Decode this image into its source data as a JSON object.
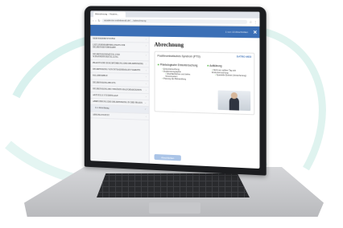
{
  "browser": {
    "tab_title": "Abrechnung – Nutzim...",
    "url": "academie.smilebrandt.de/..../abrechnung"
  },
  "app": {
    "header_meta": "1 von 13 Abschnitten",
    "close_glyph": "✕"
  },
  "sidebar": {
    "items": [
      {
        "label": "NERVENDEBITSYSTEM"
      },
      {
        "label": "LEITLINIENEMPFEHLUNGEN ZUR DELIRENSIENTHERAPIE"
      },
      {
        "label": "DELIRENSIONSMITTEL UND SCHANNERVERSTELLUNG"
      },
      {
        "label": "PRAKTISCHE DURCHFÜHRUNG DER DELIRENSIONG"
      },
      {
        "label": "DELIRENSIONG VON INTRADERMALEN VARIZEN"
      },
      {
        "label": "FALLBEISPIELE"
      },
      {
        "label": "DELIRENSIONG BEI PTS"
      },
      {
        "label": "DELIRENSIONG BEI VENÖSEN MALFORMATIONEN"
      },
      {
        "label": "AKTUELLE STUDIENLAGE"
      },
      {
        "label": "ABRECHNUNG DER DELIRENSIONG IN DER PRAXIS"
      },
      {
        "label": "11.1 Abrechnung"
      },
      {
        "label": "ABSCHLUSSTEST"
      }
    ]
  },
  "main": {
    "title": "Abrechnung",
    "card_title": "Postthrombotisches Syndrom (PTS)",
    "logo_text": "DATRO MED",
    "left_heading": "Phlebologische Erstuntersuchung",
    "left_items": [
      "Erstuntersuchung",
      "Duplexsonographie",
      "Oberflächliches und tiefes Venensystem",
      "Planung der Behandlung"
    ],
    "right_heading": "Aufklärung",
    "right_items": [
      "Nicht am selben Tag wie Erstuntersuchung",
      "Spezielle Einheit (Versicherung)"
    ],
    "cta_label": "Abschließen"
  }
}
